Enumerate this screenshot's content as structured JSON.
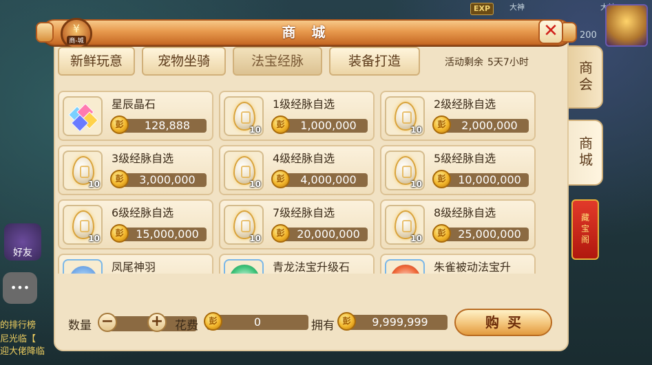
{
  "background": {
    "exp_label": "EXP",
    "top_tag_left": "大神",
    "top_tag_right": "大神",
    "level_value": "200",
    "friend_label": "好友",
    "chat_lines": [
      "的排行榜",
      "尼光临【",
      "迎大佬降临"
    ]
  },
  "header": {
    "title": "商 城",
    "badge_caption": "商-城",
    "badge_glyph": "¥"
  },
  "tabs": [
    {
      "label": "新鲜玩意",
      "active": false
    },
    {
      "label": "宠物坐骑",
      "active": false
    },
    {
      "label": "法宝经脉",
      "active": true
    },
    {
      "label": "装备打造",
      "active": false
    }
  ],
  "event": {
    "label": "活动剩余",
    "time": "5天7小时"
  },
  "items": [
    {
      "name": "星辰晶石",
      "price": "128,888",
      "icon": "crystal-icon",
      "qty": ""
    },
    {
      "name": "1级经脉自选",
      "price": "1,000,000",
      "icon": "meridian-egg-icon",
      "qty": "10"
    },
    {
      "name": "2级经脉自选",
      "price": "2,000,000",
      "icon": "meridian-egg-icon",
      "qty": "10"
    },
    {
      "name": "3级经脉自选",
      "price": "3,000,000",
      "icon": "meridian-egg-icon",
      "qty": "10"
    },
    {
      "name": "4级经脉自选",
      "price": "4,000,000",
      "icon": "meridian-egg-icon",
      "qty": "10"
    },
    {
      "name": "5级经脉自选",
      "price": "10,000,000",
      "icon": "meridian-egg-icon",
      "qty": "10"
    },
    {
      "name": "6级经脉自选",
      "price": "15,000,000",
      "icon": "meridian-egg-icon",
      "qty": "10"
    },
    {
      "name": "7级经脉自选",
      "price": "20,000,000",
      "icon": "meridian-egg-icon",
      "qty": "10"
    },
    {
      "name": "8级经脉自选",
      "price": "25,000,000",
      "icon": "meridian-egg-icon",
      "qty": "10"
    },
    {
      "name": "凤尾神羽",
      "price": "",
      "icon": "feather-icon",
      "qty": ""
    },
    {
      "name": "青龙法宝升级石",
      "price": "",
      "icon": "green-orb-icon",
      "qty": ""
    },
    {
      "name": "朱雀被动法宝升",
      "price": "",
      "icon": "red-orb-icon",
      "qty": ""
    }
  ],
  "footer": {
    "quantity_label": "数量",
    "quantity_value": "0",
    "minus": "−",
    "plus": "+",
    "cost_label": "花费",
    "cost_value": "0",
    "owned_label": "拥有",
    "owned_value": "9,999,999",
    "buy_label": "购买"
  },
  "coin_glyph": "彭",
  "side_tabs": [
    {
      "label": "商会",
      "active": false
    },
    {
      "label": "商城",
      "active": true
    },
    {
      "label": "藏宝阁",
      "active": false
    }
  ],
  "close_glyph": "✕"
}
